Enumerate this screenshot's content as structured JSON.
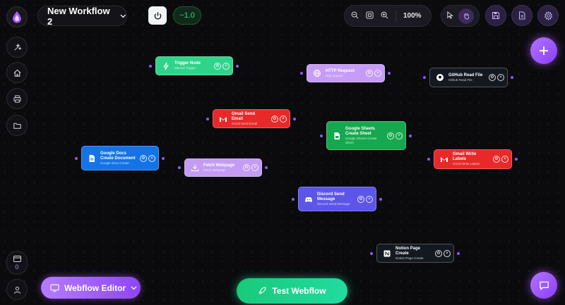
{
  "workflow": {
    "title": "New Workflow 2",
    "version": "~1.0"
  },
  "toolbar": {
    "zoom_percent": "100%"
  },
  "sidebar": {
    "counter": "0"
  },
  "bottom": {
    "editor_label": "Webflow Editor",
    "test_label": "Test Webflow"
  },
  "nodes": [
    {
      "title": "Trigger Node",
      "subtitle": "Manual Trigger",
      "icon": "bolt-icon",
      "color": "#2fd48a"
    },
    {
      "title": "HTTP Request",
      "subtitle": "Http request",
      "icon": "globe-icon",
      "color": "#c79cf7"
    },
    {
      "title": "GitHub Read File",
      "subtitle": "Github Read File",
      "icon": "github-icon",
      "color": "#141820"
    },
    {
      "title": "Gmail Send Email",
      "subtitle": "Gmail Send Email",
      "icon": "gmail-icon",
      "color": "#e82929"
    },
    {
      "title": "Google Sheets Create Sheet",
      "subtitle": "Google Sheets Create Sheet",
      "icon": "sheets-icon",
      "color": "#16a84e"
    },
    {
      "title": "Google Docs Create Document",
      "subtitle": "Google Docs Create",
      "icon": "docs-icon",
      "color": "#1473e6"
    },
    {
      "title": "Fetch Webpage",
      "subtitle": "Fetch Webpage",
      "icon": "download-icon",
      "color": "#c49cf3"
    },
    {
      "title": "Gmail Write Labels",
      "subtitle": "Gmail Write Labels",
      "icon": "gmail-icon",
      "color": "#e82929"
    },
    {
      "title": "Discord Send Message",
      "subtitle": "Discord Send Message",
      "icon": "discord-icon",
      "color": "#5b55e8"
    },
    {
      "title": "Notion Page Create",
      "subtitle": "Notion Page Create",
      "icon": "notion-icon",
      "color": "#141820"
    }
  ]
}
